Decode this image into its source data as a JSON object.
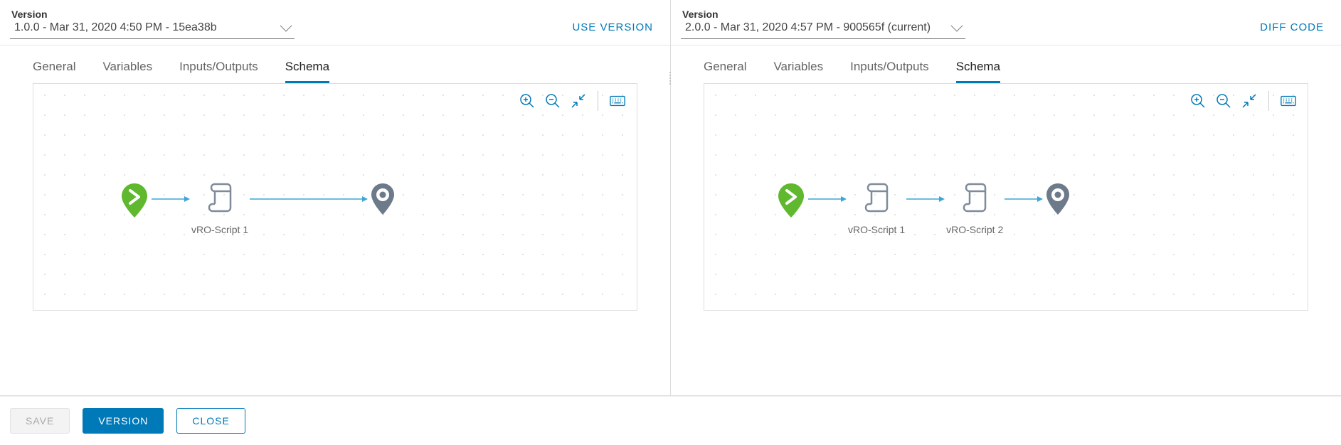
{
  "left": {
    "label": "Version",
    "value": "1.0.0 - Mar 31, 2020 4:50 PM - 15ea38b",
    "action": "USE VERSION",
    "tabs": [
      "General",
      "Variables",
      "Inputs/Outputs",
      "Schema"
    ],
    "active_tab": "Schema",
    "flow": {
      "nodes": [
        {
          "type": "start"
        },
        {
          "type": "script",
          "label": "vRO-Script 1"
        },
        {
          "type": "end"
        }
      ]
    }
  },
  "right": {
    "label": "Version",
    "value": "2.0.0 - Mar 31, 2020 4:57 PM - 900565f (current)",
    "action": "DIFF CODE",
    "tabs": [
      "General",
      "Variables",
      "Inputs/Outputs",
      "Schema"
    ],
    "active_tab": "Schema",
    "flow": {
      "nodes": [
        {
          "type": "start"
        },
        {
          "type": "script",
          "label": "vRO-Script 1"
        },
        {
          "type": "script",
          "label": "vRO-Script 2"
        },
        {
          "type": "end"
        }
      ]
    }
  },
  "canvas_tools": {
    "zoom_in": "zoom-in",
    "zoom_out": "zoom-out",
    "fit": "fit-to-screen",
    "keyboard": "keyboard"
  },
  "footer": {
    "save": "SAVE",
    "version": "VERSION",
    "close": "CLOSE"
  }
}
